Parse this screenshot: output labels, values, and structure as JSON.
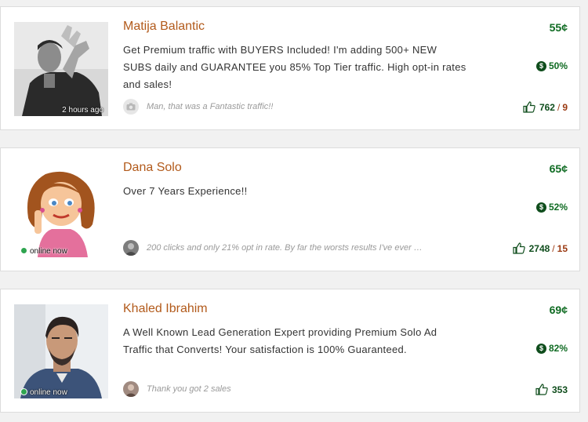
{
  "sellers": [
    {
      "name": "Matija Balantic",
      "description": "Get Premium traffic with BUYERS Included! I'm adding 500+ NEW SUBS daily and GUARANTEE you 85% Top Tier traffic. High opt-in rates and sales!",
      "status": "2 hours ago",
      "status_type": "time",
      "review": "Man, that was a Fantastic traffic!!",
      "price": "55¢",
      "tier_pct": "50%",
      "votes_positive": "762",
      "votes_negative": "9"
    },
    {
      "name": "Dana Solo",
      "description": "Over 7 Years Experience!!",
      "status": "online now",
      "status_type": "online",
      "review": "200 clicks and only 21% opt in rate. By far the worsts results I've ever …",
      "price": "65¢",
      "tier_pct": "52%",
      "votes_positive": "2748",
      "votes_negative": "15"
    },
    {
      "name": "Khaled Ibrahim",
      "description": "A Well Known Lead Generation Expert providing Premium Solo Ad Traffic that Converts! Your satisfaction is 100% Guaranteed.",
      "status": "online now",
      "status_type": "online",
      "review": "Thank you got 2 sales",
      "price": "69¢",
      "tier_pct": "82%",
      "votes_positive": "353"
    }
  ],
  "icons": {
    "tier": "dollar-badge-icon",
    "votes": "thumbs-up-icon",
    "review_placeholder": "camera-icon"
  },
  "colors": {
    "name": "#b25a1b",
    "price": "#0f6b22",
    "negative": "#9b3a12",
    "online": "#2ea44f"
  }
}
